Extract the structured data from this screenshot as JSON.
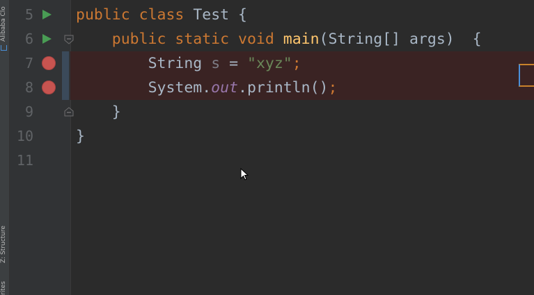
{
  "side_tabs": {
    "alibaba": "Alibaba Clo",
    "structure": "Z: Structure",
    "favorites": "rites"
  },
  "lines": [
    {
      "number": "5",
      "gutter": "run"
    },
    {
      "number": "6",
      "gutter": "run"
    },
    {
      "number": "7",
      "gutter": "breakpoint"
    },
    {
      "number": "8",
      "gutter": "breakpoint"
    },
    {
      "number": "9",
      "gutter": ""
    },
    {
      "number": "10",
      "gutter": ""
    },
    {
      "number": "11",
      "gutter": ""
    }
  ],
  "code": {
    "line5": {
      "kw1": "public",
      "kw2": "class",
      "name": "Test",
      "brace": "{"
    },
    "line6": {
      "kw1": "public",
      "kw2": "static",
      "kw3": "void",
      "method": "main",
      "params": "(String[] args)",
      "brace": "{"
    },
    "line7": {
      "type": "String",
      "var": "s",
      "eq": "=",
      "string": "\"xyz\"",
      "semi": ";"
    },
    "line8": {
      "obj": "System.",
      "field": "out",
      "call": ".println()",
      "semi": ";"
    },
    "line9": {
      "brace": "}"
    },
    "line10": {
      "brace": "}"
    }
  },
  "colors": {
    "background": "#2b2b2b",
    "keyword": "#cc7832",
    "method": "#ffc66d",
    "string": "#6a8759",
    "field": "#9876aa",
    "breakpoint": "#c75450",
    "run": "#499c54",
    "breakpoint_line": "#3a2323"
  }
}
